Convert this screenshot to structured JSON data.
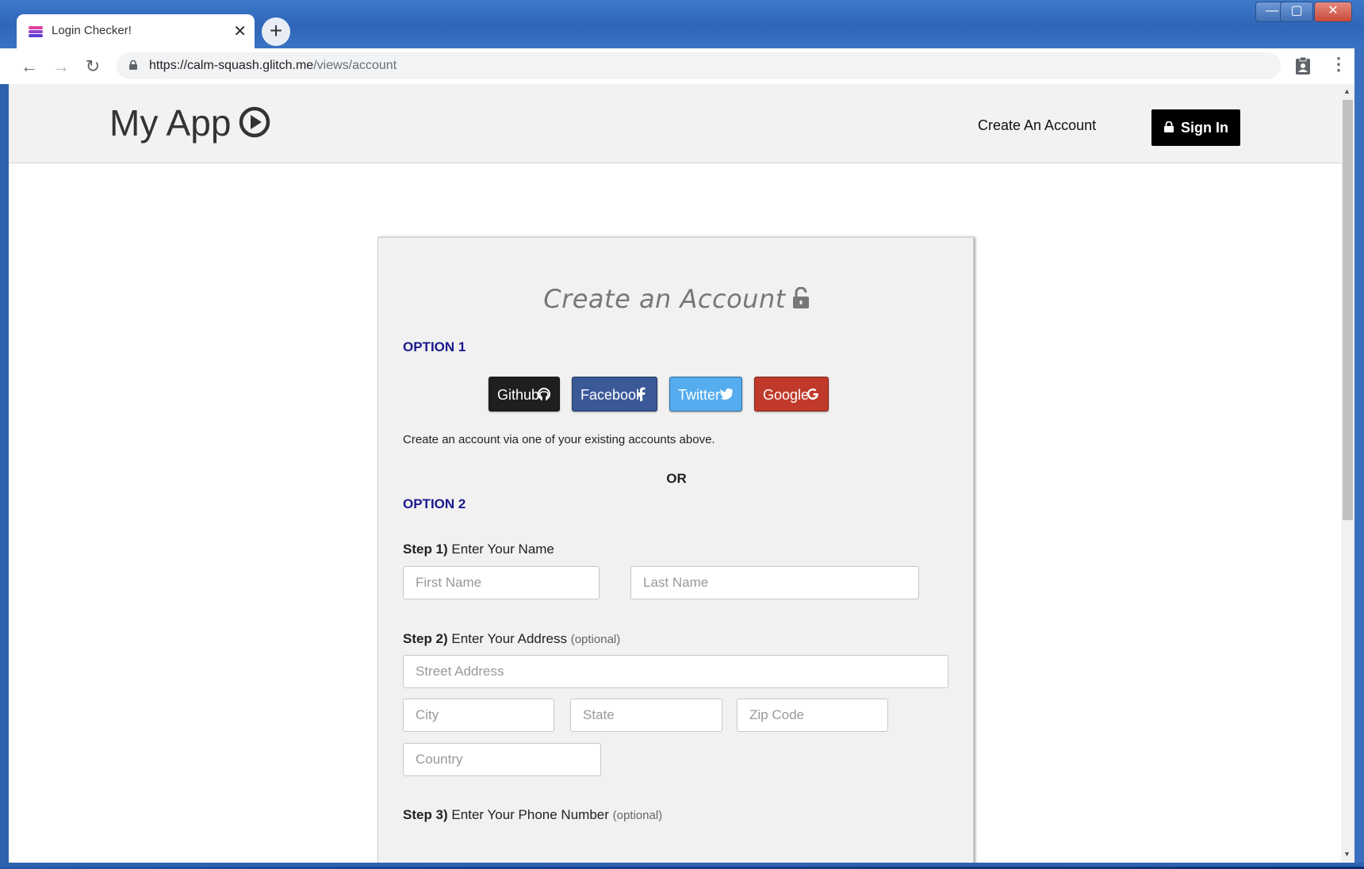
{
  "browser": {
    "tab_title": "Login Checker!",
    "tab_close": "✕",
    "new_tab": "+",
    "url_host": "https://calm-squash.glitch.me",
    "url_path": "/views/account",
    "window_controls": {
      "minimize": "—",
      "maximize": "▢",
      "close": "✕"
    }
  },
  "header": {
    "brand": "My App",
    "nav_create": "Create An Account",
    "signin": "Sign In"
  },
  "card": {
    "title": "Create an Account",
    "option1": "OPTION 1",
    "social": [
      {
        "label": "Github",
        "icon": "github-icon",
        "color": "#1f1f1f"
      },
      {
        "label": "Facebook",
        "icon": "facebook-icon",
        "color": "#3b5998"
      },
      {
        "label": "Twitter",
        "icon": "twitter-icon",
        "color": "#55acee"
      },
      {
        "label": "Google",
        "icon": "google-icon",
        "color": "#c0392b"
      }
    ],
    "social_desc": "Create an account via one of your existing accounts above.",
    "or": "OR",
    "option2": "OPTION 2",
    "step1": {
      "num": "Step 1)",
      "text": "Enter Your Name"
    },
    "step2": {
      "num": "Step 2)",
      "text": "Enter Your Address",
      "optional": "(optional)"
    },
    "step3": {
      "num": "Step 3)",
      "text": "Enter Your Phone Number",
      "optional": "(optional)"
    },
    "placeholders": {
      "first_name": "First Name",
      "last_name": "Last Name",
      "street": "Street Address",
      "city": "City",
      "state": "State",
      "zip": "Zip Code",
      "country": "Country"
    }
  },
  "colors": {
    "option_label": "#1a1a8c",
    "header_bg": "#f2f2f2",
    "card_bg": "#f1f1f1"
  }
}
